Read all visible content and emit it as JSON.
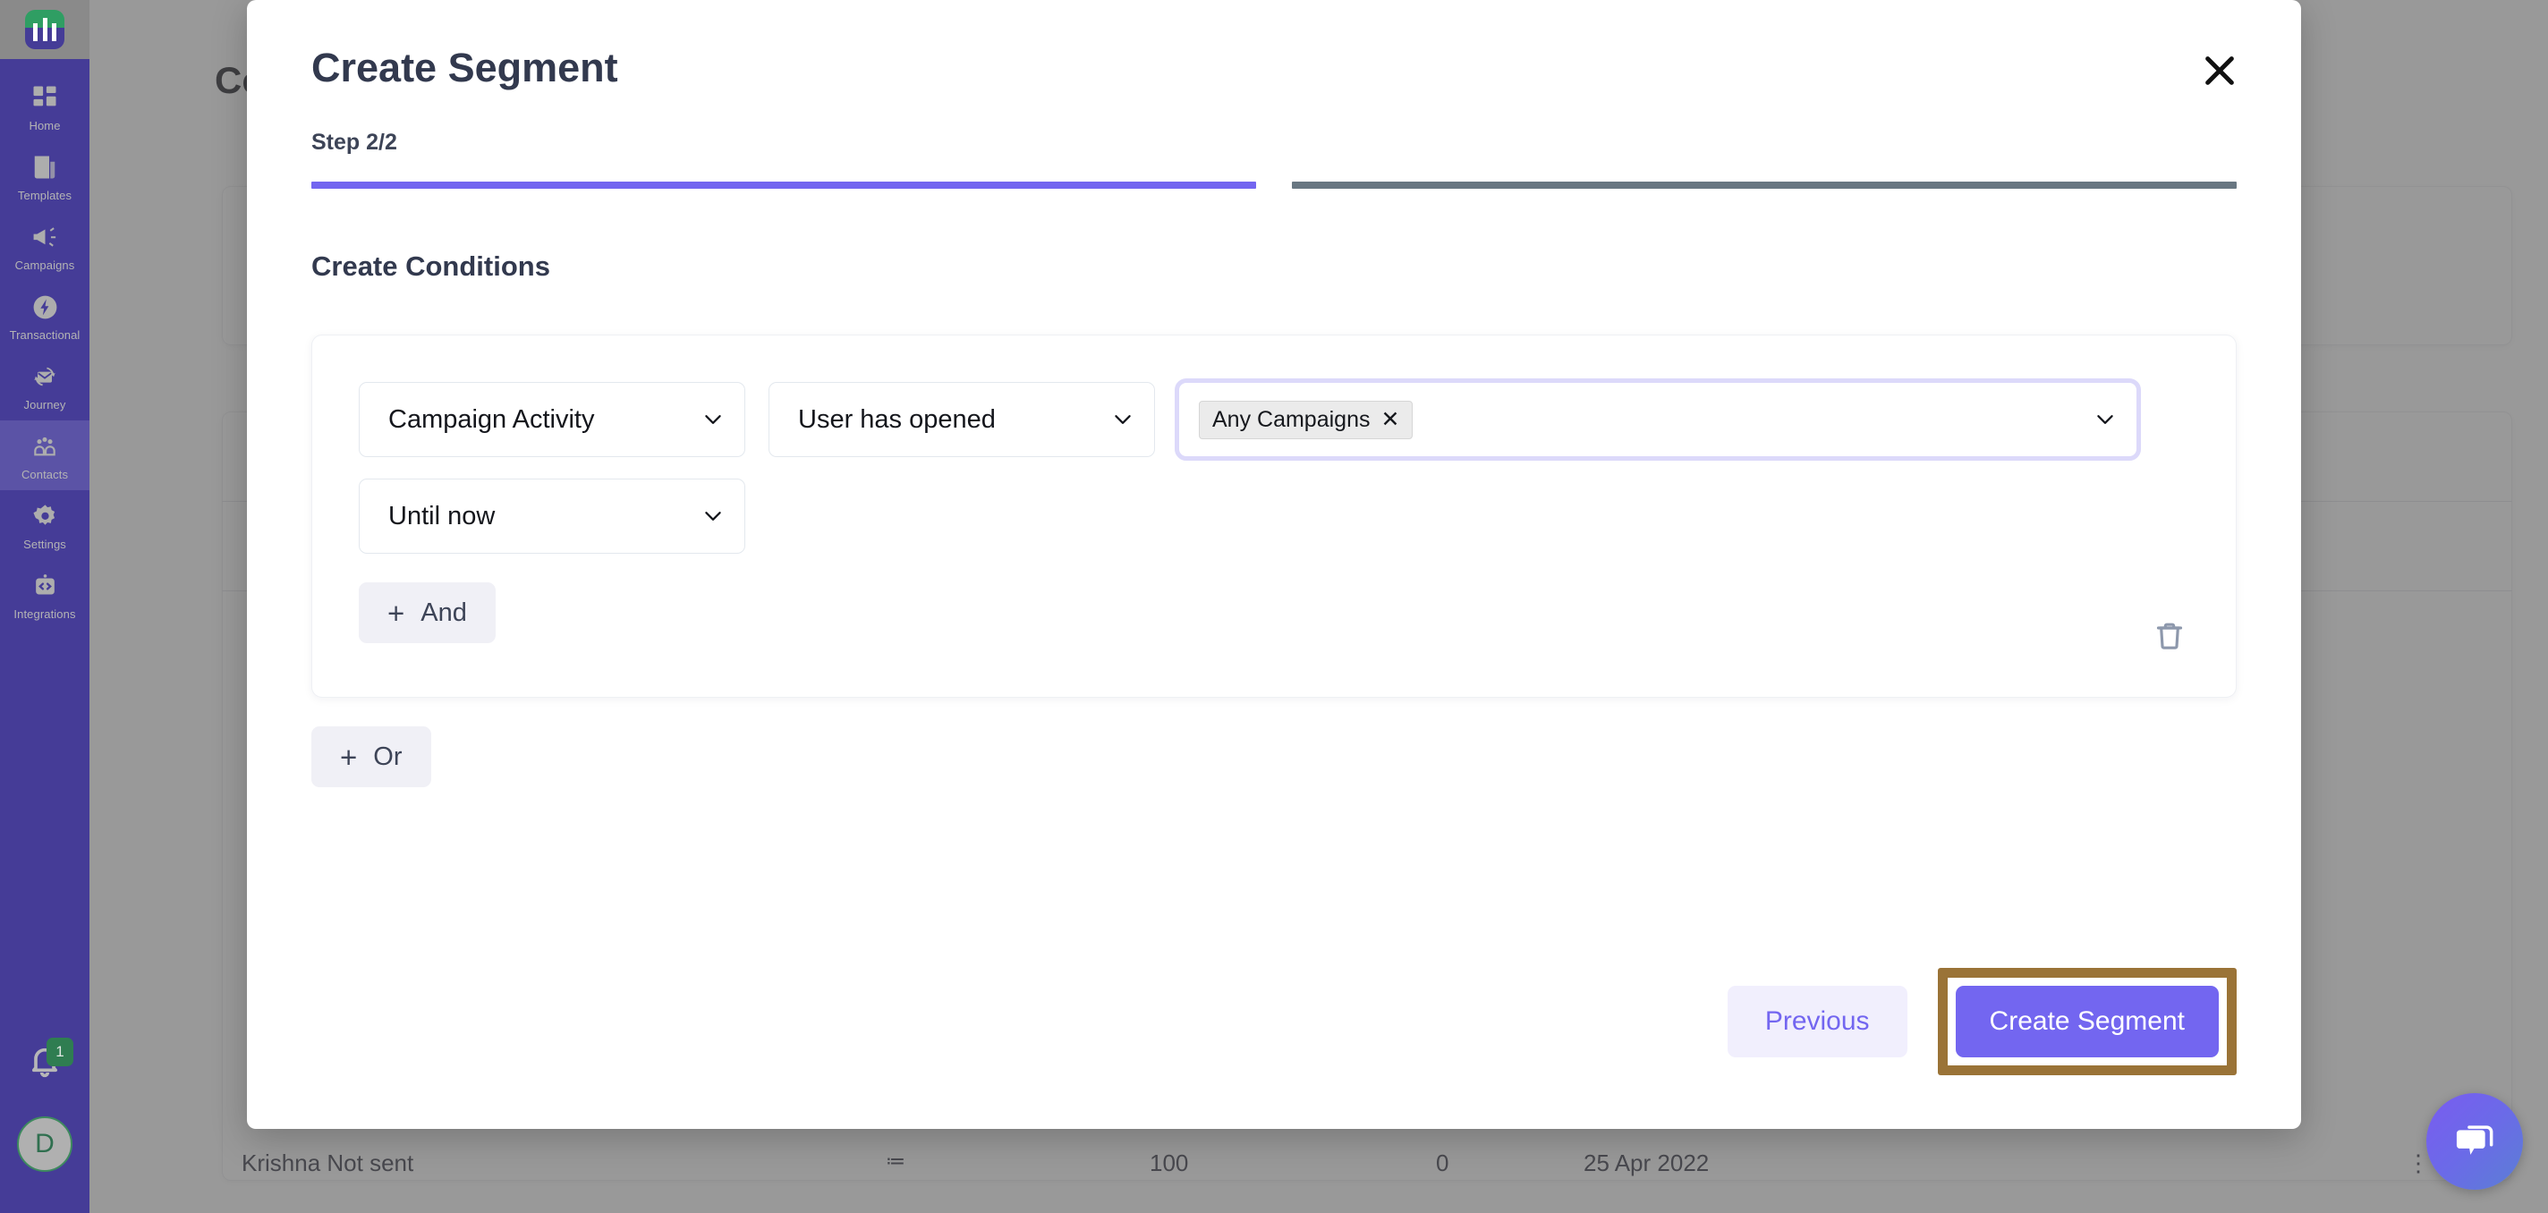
{
  "sidebar": {
    "brand_name": "mailmodo-logo",
    "items": [
      {
        "label": "Home",
        "icon": "grid-icon",
        "active": false
      },
      {
        "label": "Templates",
        "icon": "templates-icon",
        "active": false
      },
      {
        "label": "Campaigns",
        "icon": "megaphone-icon",
        "active": false
      },
      {
        "label": "Transactional",
        "icon": "bolt-icon",
        "active": false
      },
      {
        "label": "Journey",
        "icon": "journey-envelope-icon",
        "active": false
      },
      {
        "label": "Contacts",
        "icon": "contacts-icon",
        "active": true
      },
      {
        "label": "Settings",
        "icon": "gear-icon",
        "active": false
      },
      {
        "label": "Integrations",
        "icon": "code-badge-icon",
        "active": false
      }
    ],
    "notification_count": "1",
    "avatar_initial": "D"
  },
  "background": {
    "page_title": "Co",
    "row": {
      "name": "Krishna Not sent",
      "list": "≔",
      "value_a": "100",
      "value_b": "0",
      "date": "25 Apr 2022",
      "menu": "⋮"
    }
  },
  "modal": {
    "title": "Create Segment",
    "close_label": "×",
    "step_label": "Step 2/2",
    "steps": [
      {
        "name": "step-1",
        "state": "done"
      },
      {
        "name": "step-2",
        "state": "todo"
      }
    ],
    "section_title": "Create Conditions",
    "condition_group": {
      "attribute_select": {
        "value": "Campaign Activity"
      },
      "operator_select": {
        "value": "User has opened"
      },
      "value_multiselect": {
        "chips": [
          {
            "label": "Any Campaigns",
            "remove": "✕"
          }
        ],
        "placeholder": ""
      },
      "timeframe_select": {
        "value": "Until now"
      },
      "and_button": {
        "plus": "+",
        "label": "And"
      },
      "delete_icon": "trash-icon"
    },
    "or_button": {
      "plus": "+",
      "label": "Or"
    },
    "footer": {
      "previous_label": "Previous",
      "create_label": "Create Segment"
    }
  },
  "chat": {
    "icon": "chat-bubble-icon"
  },
  "colors": {
    "accent_purple": "#7366f0",
    "sidebar_purple": "#453C97",
    "step_todo_gray": "#697782",
    "highlight_brown": "#9a7337",
    "badge_green": "#2f7d51"
  }
}
